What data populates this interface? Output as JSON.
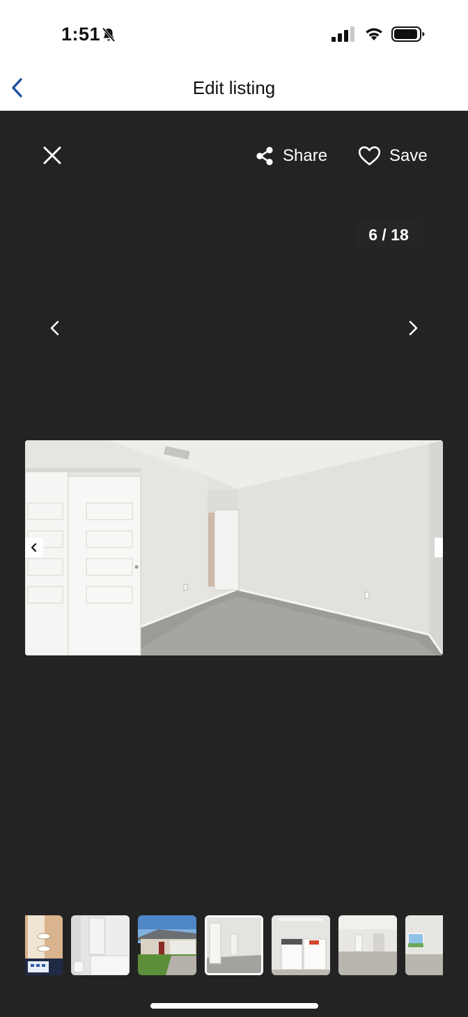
{
  "status_bar": {
    "time": "1:51"
  },
  "nav": {
    "title": "Edit listing"
  },
  "viewer": {
    "share_label": "Share",
    "save_label": "Save",
    "counter": "6 / 18"
  },
  "thumbnails": [
    {
      "name": "bathroom-partial"
    },
    {
      "name": "bathroom"
    },
    {
      "name": "house-exterior"
    },
    {
      "name": "bedroom-closet",
      "active": true
    },
    {
      "name": "laundry-room"
    },
    {
      "name": "living-room"
    },
    {
      "name": "bedroom-window"
    }
  ]
}
